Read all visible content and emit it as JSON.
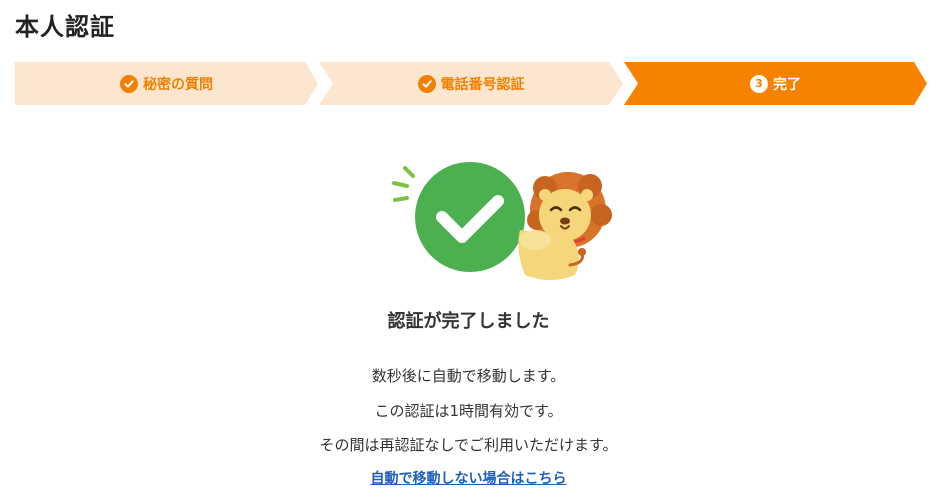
{
  "page": {
    "title": "本人認証"
  },
  "steps": [
    {
      "label": "秘密の質問",
      "status": "completed",
      "icon": "check-icon"
    },
    {
      "label": "電話番号認証",
      "status": "completed",
      "icon": "check-icon"
    },
    {
      "label": "完了",
      "status": "current",
      "number": "3"
    }
  ],
  "main": {
    "heading": "認証が完了しました",
    "messages": [
      "数秒後に自動で移動します。",
      "この認証は1時間有効です。",
      "その間は再認証なしでご利用いただけます。"
    ],
    "link_label": "自動で移動しない場合はこちら",
    "illustration": {
      "icons": [
        "success-check-icon",
        "lion-mascot-icon"
      ]
    }
  },
  "colors": {
    "accent": "#f78200",
    "step_done_bg": "#fde6cf",
    "step_done_text": "#f08100",
    "success_green": "#4caf50",
    "link": "#1f5fb8"
  }
}
